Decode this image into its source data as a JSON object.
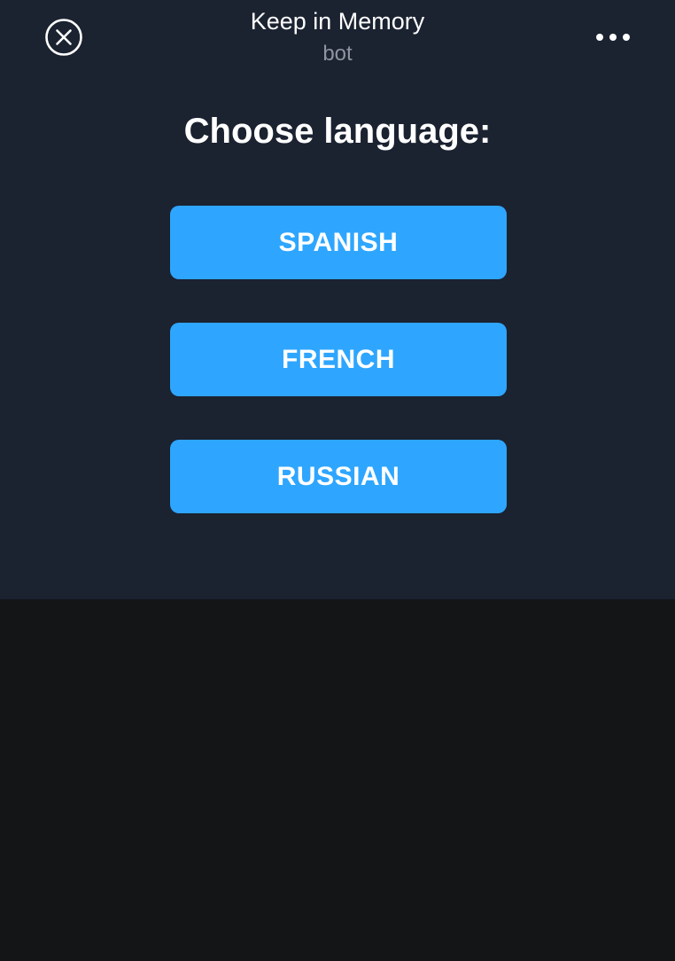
{
  "header": {
    "title": "Keep in Memory",
    "subtitle": "bot",
    "close_icon": "close-circle-icon",
    "more_icon": "more-horizontal-icon"
  },
  "main": {
    "heading": "Choose language:",
    "languages": [
      {
        "label": "SPANISH"
      },
      {
        "label": "FRENCH"
      },
      {
        "label": "RUSSIAN"
      }
    ]
  },
  "colors": {
    "webapp_background": "#1b2230",
    "page_background": "#141517",
    "button": "#2ea6ff",
    "text": "#ffffff",
    "subtitle": "#8e959e"
  }
}
